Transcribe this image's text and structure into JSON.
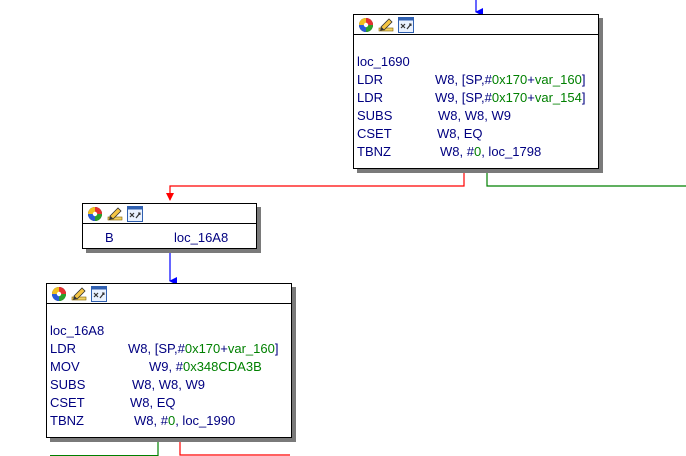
{
  "colors": {
    "edge_true": "#ff0000",
    "edge_false": "#008000",
    "edge_uncond": "#0000ff",
    "text": "#000080",
    "number": "#008000",
    "shadow": "#7a7a7a"
  },
  "header_icons": [
    "color-palette-icon",
    "rename-pencil-icon",
    "graph-layout-icon"
  ],
  "blocks": {
    "b1": {
      "label": "loc_1690",
      "lines": [
        {
          "mnem": "LDR",
          "op_pre": "W8, [SP,#",
          "op_num1": "0x170",
          "op_mid": "+",
          "op_num2": "var_160",
          "op_post": "]"
        },
        {
          "mnem": "LDR",
          "op_pre": "W9, [SP,#",
          "op_num1": "0x170",
          "op_mid": "+",
          "op_num2": "var_154",
          "op_post": "]"
        },
        {
          "mnem": "SUBS",
          "op_pre": "W8, W8, W9",
          "op_num1": "",
          "op_mid": "",
          "op_num2": "",
          "op_post": ""
        },
        {
          "mnem": "CSET",
          "op_pre": "W8, EQ",
          "op_num1": "",
          "op_mid": "",
          "op_num2": "",
          "op_post": ""
        },
        {
          "mnem": "TBNZ",
          "op_pre": "W8, #",
          "op_num1": "0",
          "op_mid": ", loc_1798",
          "op_num2": "",
          "op_post": ""
        }
      ]
    },
    "b2": {
      "lines": [
        {
          "mnem": "B",
          "op_pre": "loc_16A8"
        }
      ]
    },
    "b3": {
      "label": "loc_16A8",
      "lines": [
        {
          "mnem": "LDR",
          "op_pre": "W8, [SP,#",
          "op_num1": "0x170",
          "op_mid": "+",
          "op_num2": "var_160",
          "op_post": "]"
        },
        {
          "mnem": "MOV",
          "op_pre": "W9, #",
          "op_num1": "0x348CDA3B",
          "op_mid": "",
          "op_num2": "",
          "op_post": ""
        },
        {
          "mnem": "SUBS",
          "op_pre": "W8, W8, W9",
          "op_num1": "",
          "op_mid": "",
          "op_num2": "",
          "op_post": ""
        },
        {
          "mnem": "CSET",
          "op_pre": "W8, EQ",
          "op_num1": "",
          "op_mid": "",
          "op_num2": "",
          "op_post": ""
        },
        {
          "mnem": "TBNZ",
          "op_pre": "W8, #",
          "op_num1": "0",
          "op_mid": ", loc_1990",
          "op_num2": "",
          "op_post": ""
        }
      ]
    }
  }
}
